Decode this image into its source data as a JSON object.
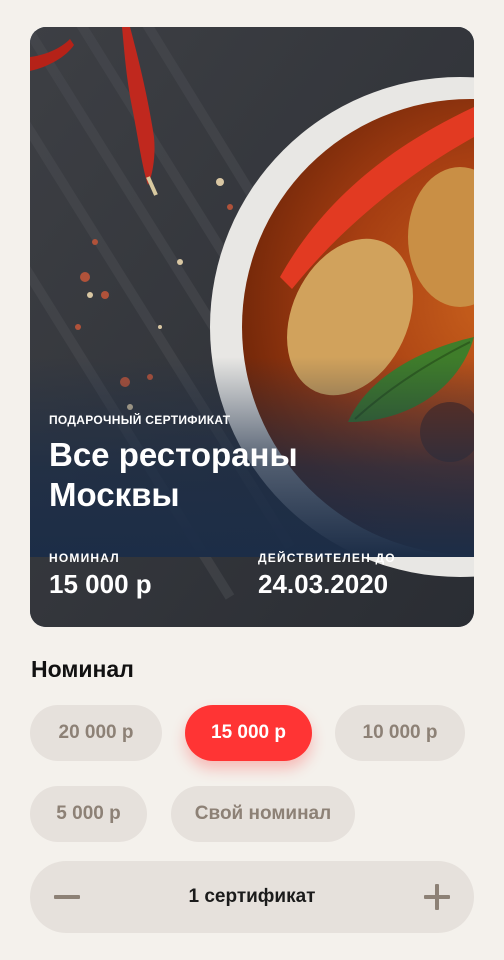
{
  "card": {
    "eyebrow": "ПОДАРОЧНЫЙ СЕРТИФИКАТ",
    "title_line1": "Все рестораны",
    "title_line2": "Москвы",
    "nominal_label": "НОМИНАЛ",
    "nominal_value": "15 000 р",
    "valid_label": "ДЕЙСТВИТЕЛЕН ДО",
    "valid_value": "24.03.2020",
    "background_color": "#1c2d47",
    "image_subject": "food-photo"
  },
  "section": {
    "title": "Номинал"
  },
  "nominal_options": [
    {
      "label": "20 000 р",
      "selected": false
    },
    {
      "label": "15 000 р",
      "selected": true
    },
    {
      "label": "10 000 р",
      "selected": false
    },
    {
      "label": "5 000 р",
      "selected": false
    },
    {
      "label": "Свой номинал",
      "selected": false
    }
  ],
  "quantity": {
    "label": "1 сертификат",
    "minus_icon": "minus-icon",
    "plus_icon": "plus-icon"
  },
  "colors": {
    "accent": "#ff3434",
    "chip_bg": "#e6e1dc",
    "chip_text": "#8d8176",
    "page_bg": "#f4f1ec"
  }
}
